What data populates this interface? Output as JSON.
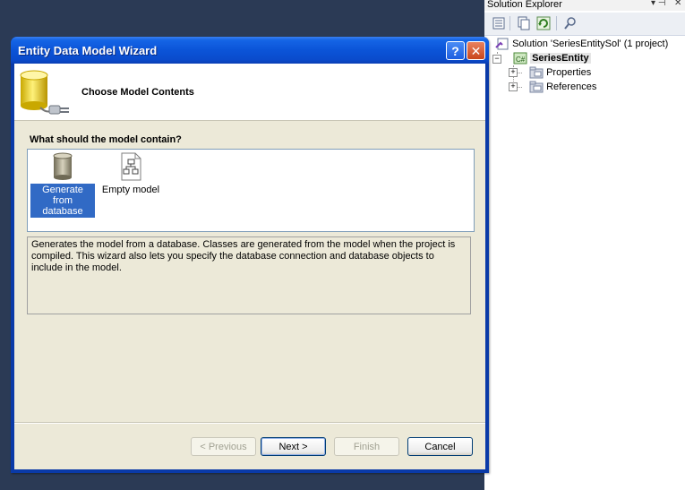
{
  "solution_explorer": {
    "title": "Solution Explorer",
    "pin_glyph": "▾ ⊣",
    "close_glyph": "✕",
    "toolbar_icons": [
      "properties-icon",
      "show-all-files-icon",
      "refresh-icon",
      "class-diagram-icon"
    ],
    "tree": {
      "solution_label": "Solution 'SeriesEntitySol' (1 project)",
      "project_label": "SeriesEntity",
      "children": [
        {
          "label": "Properties",
          "expander": "+"
        },
        {
          "label": "References",
          "expander": "+"
        }
      ],
      "project_expander": "−"
    }
  },
  "wizard": {
    "title": "Entity Data Model Wizard",
    "help_glyph": "?",
    "close_glyph": "✕",
    "header_title": "Choose Model Contents",
    "question": "What should the model contain?",
    "choices": [
      {
        "label": "Generate from database",
        "selected": true,
        "icon": "database-icon"
      },
      {
        "label": "Empty model",
        "selected": false,
        "icon": "empty-model-icon"
      }
    ],
    "description": "Generates the model from a database. Classes are generated from the model when the project is compiled. This wizard also lets you specify the database connection and database objects to include in the model.",
    "buttons": {
      "previous": "< Previous",
      "next": "Next >",
      "finish": "Finish",
      "cancel": "Cancel"
    }
  },
  "colors": {
    "titlebar_blue": "#0b54d8",
    "selection_blue": "#316ac5",
    "dialog_face": "#ece9d8",
    "desktop": "#2b3a55"
  }
}
